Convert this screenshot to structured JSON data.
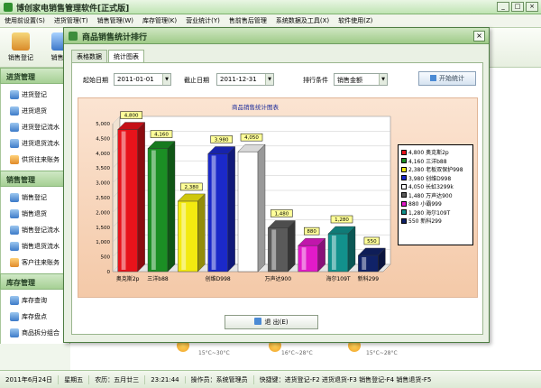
{
  "app": {
    "title": "博创家电销售管理软件[正式版]",
    "menu": [
      "使用前设置(S)",
      "进货管理(T)",
      "销售管理(W)",
      "库存管理(K)",
      "营业统计(Y)",
      "售前售后管理",
      "系统数据及工具(X)",
      "软件使用(Z)"
    ],
    "window_buttons": [
      "_",
      "□",
      "×"
    ]
  },
  "toolbar": [
    {
      "label": "销售登记",
      "icon": "sales-register-icon"
    },
    {
      "label": "销售退",
      "icon": "sales-return-icon"
    }
  ],
  "sidebar": {
    "groups": [
      {
        "title": "进货管理",
        "items": [
          "进货登记",
          "进货退货",
          "进货登记流水",
          "进货退货流水",
          "供货往来账务"
        ]
      },
      {
        "title": "销售管理",
        "items": [
          "销售登记",
          "销售退货",
          "销售登记流水",
          "销售退货流水",
          "客户往来账务"
        ]
      },
      {
        "title": "库存管理",
        "items": [
          "库存查询",
          "库存盘点",
          "商品拆分组合"
        ]
      }
    ]
  },
  "background": {
    "weather": [
      "15°C~30°C",
      "16°C~28°C",
      "15°C~28°C"
    ]
  },
  "status": [
    "2011年6月24日",
    "星期五",
    "农历：五月廿三",
    "23:21:44",
    "操作员：系统管理员",
    "快捷键：进货登记-F2 进货退货-F3 销售登记-F4 销售退货-F5"
  ],
  "dialog": {
    "title": "商品销售统计排行",
    "close": "×",
    "tabs": [
      "表格数据",
      "统计图表"
    ],
    "active_tab": 1,
    "filters": {
      "start_label": "起始日期",
      "start_value": "2011-01-01",
      "end_label": "截止日期",
      "end_value": "2011-12-31",
      "sort_label": "排行条件",
      "sort_value": "销售金额",
      "dropdown_arrow": "▼"
    },
    "stat_button": "开始统计",
    "exit_button": "退  出(E)"
  },
  "chart_data": {
    "type": "bar",
    "title": "商品销售统计图表",
    "categories": [
      "奥克斯2p",
      "三洋b88",
      "老板双保护998",
      "创维D998",
      "长虹3299k",
      "万声达900",
      "小霸999",
      "海尔109T",
      "新科299"
    ],
    "values": [
      4800,
      4160,
      2380,
      3980,
      4050,
      1480,
      880,
      1280,
      550
    ],
    "shown_category_labels": [
      "奥克斯2p",
      "三洋b88",
      "",
      "创维D998",
      "",
      "万声达900",
      "",
      "海尔109T",
      "新科299"
    ],
    "legend_labels": [
      "4,800 奥克斯2p",
      "4,160 三洋b88",
      "2,380 老板双保护998",
      "3,980 创维D998",
      "4,050 长虹3299k",
      "1,480 万声达900",
      "880 小霸999",
      "1,280 海尔109T",
      "550 新科299"
    ],
    "value_labels": [
      "4,800",
      "4,160",
      "2,380",
      "3,980",
      "4,050",
      "1,480",
      "880",
      "1,280",
      "550"
    ],
    "colors": [
      "#e8131b",
      "#1b8f24",
      "#f3ea10",
      "#1b29c9",
      "#ffffff",
      "#5a5a5a",
      "#e21ac9",
      "#12918c",
      "#102268"
    ],
    "yticks": [
      "0",
      "500",
      "1,000",
      "1,500",
      "2,000",
      "2,500",
      "3,000",
      "3,500",
      "4,000",
      "4,500",
      "5,000"
    ],
    "ylim": [
      0,
      5000
    ],
    "grid": true,
    "legend_position": "right"
  }
}
